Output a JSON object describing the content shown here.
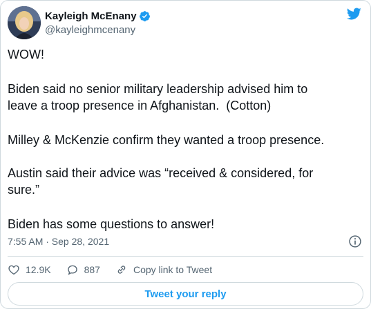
{
  "author": {
    "name": "Kayleigh McEnany",
    "handle": "@kayleighmcenany",
    "verified": true
  },
  "tweet": {
    "paragraphs": [
      "WOW!",
      "Biden said no senior military leadership advised him to\nleave a troop presence in Afghanistan.  (Cotton)",
      "Milley & McKenzie confirm they wanted a troop presence.",
      "Austin said their advice was “received & considered, for\nsure.”",
      "Biden has some questions to answer!"
    ],
    "timestamp": "7:55 AM · Sep 28, 2021"
  },
  "actions": {
    "likes": "12.9K",
    "replies": "887",
    "copy_link_label": "Copy link to Tweet"
  },
  "reply_button_label": "Tweet your reply",
  "colors": {
    "accent": "#1d9bf0",
    "text": "#0f1419",
    "secondary": "#536471",
    "border": "#cfd9de"
  },
  "icons": [
    "verified-badge-icon",
    "twitter-bird-icon",
    "info-icon",
    "heart-icon",
    "reply-bubble-icon",
    "link-icon"
  ]
}
